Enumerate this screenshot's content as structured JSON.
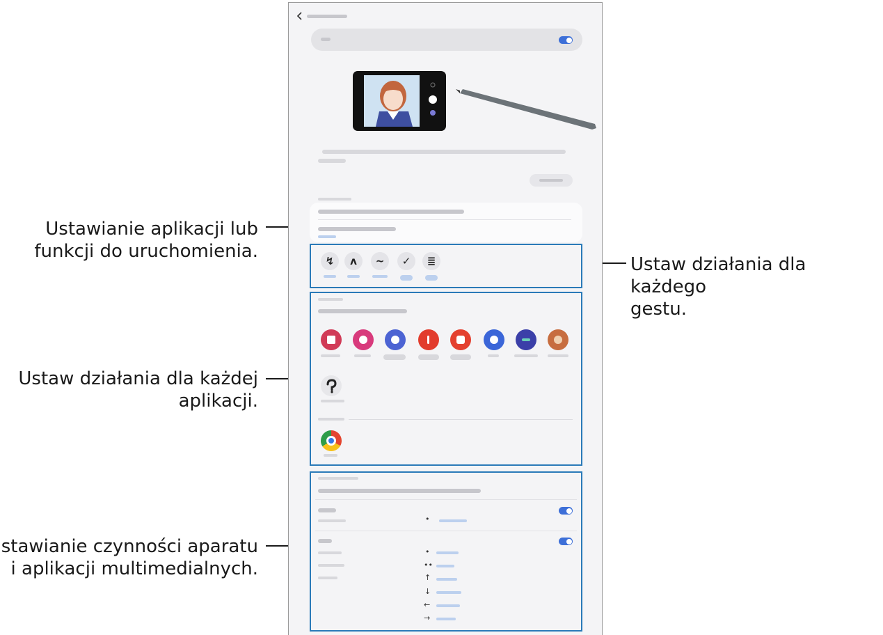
{
  "callouts": {
    "app_function": [
      "Ustawianie aplikacji lub",
      "funkcji do uruchomienia."
    ],
    "gestures": [
      "Ustaw działania dla każdego",
      "gestu."
    ],
    "apps": [
      "Ustaw działania dla każdej",
      "aplikacji."
    ],
    "camera_media": [
      "Ustawianie czynności aparatu",
      "i aplikacji multimedialnych."
    ]
  },
  "phone": {
    "back_icon": "chevron-left",
    "gesture_icons": [
      "↯",
      "ʌ",
      "~",
      "✓",
      "≣"
    ],
    "arrows": [
      "•",
      "••",
      "↑",
      "↓",
      "←",
      "→",
      "•"
    ],
    "colors": {
      "accent": "#3d6fd8",
      "highlight": "#2a7ab8"
    }
  }
}
